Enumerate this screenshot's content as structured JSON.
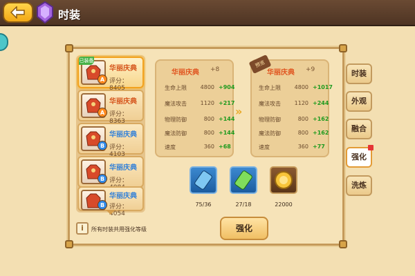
{
  "header": {
    "title": "时装",
    "back_icon": "back-arrow-icon",
    "gem_icon": "purple-gem-icon"
  },
  "list": [
    {
      "name": "华丽庆典",
      "score_label": "评分",
      "score": "8405",
      "equipped_tag": "已装备",
      "badge": "A",
      "badge_color": "#ff8a1e",
      "selected": true,
      "name_color": "#d5531a"
    },
    {
      "name": "华丽庆典",
      "score_label": "评分",
      "score": "8363",
      "badge": "A",
      "badge_color": "#ff8a1e",
      "name_color": "#d5531a"
    },
    {
      "name": "华丽庆典",
      "score_label": "评分",
      "score": "4103",
      "badge": "B",
      "badge_color": "#2f89e8",
      "name_color": "#2f7fd9"
    },
    {
      "name": "华丽庆典",
      "score_label": "评分",
      "score": "4084",
      "badge": "B",
      "badge_color": "#2f89e8",
      "name_color": "#2f7fd9"
    },
    {
      "name": "华丽庆典",
      "score_label": "评分",
      "score": "4054",
      "badge": "B",
      "badge_color": "#2f89e8",
      "name_color": "#2f7fd9"
    }
  ],
  "current": {
    "title": "华丽庆典",
    "level": "+8",
    "stats": [
      {
        "label": "生命上限",
        "value": "4800",
        "gain": "+904"
      },
      {
        "label": "魔法攻击",
        "value": "1120",
        "gain": "+217"
      },
      {
        "label": "物理防御",
        "value": "800",
        "gain": "+144"
      },
      {
        "label": "魔法防御",
        "value": "800",
        "gain": "+144"
      },
      {
        "label": "速度",
        "value": "360",
        "gain": "+68"
      }
    ]
  },
  "preview": {
    "tag": "预览",
    "title": "华丽庆典",
    "level": "+9",
    "stats": [
      {
        "label": "生命上限",
        "value": "4800",
        "gain": "+1017"
      },
      {
        "label": "魔法攻击",
        "value": "1120",
        "gain": "+244"
      },
      {
        "label": "物理防御",
        "value": "800",
        "gain": "+162"
      },
      {
        "label": "魔法防御",
        "value": "800",
        "gain": "+162"
      },
      {
        "label": "速度",
        "value": "360",
        "gain": "+77"
      }
    ]
  },
  "arrow": "»",
  "materials": [
    {
      "icon": "blue-scroll-icon",
      "count": "75/36"
    },
    {
      "icon": "green-scroll-icon",
      "count": "27/18"
    },
    {
      "icon": "gold-coin-icon",
      "count": "22000"
    }
  ],
  "hint": {
    "icon_text": "i",
    "text": "所有时装共用强化等级"
  },
  "strengthen_button": "强化",
  "tabs": [
    {
      "label": "时装",
      "active": false
    },
    {
      "label": "外观",
      "active": false
    },
    {
      "label": "融合",
      "active": false
    },
    {
      "label": "强化",
      "active": true
    },
    {
      "label": "洗炼",
      "active": false
    }
  ],
  "colors": {
    "accent": "#e0541f",
    "gain": "#1e9a1e",
    "panel": "#f6e3b8"
  }
}
